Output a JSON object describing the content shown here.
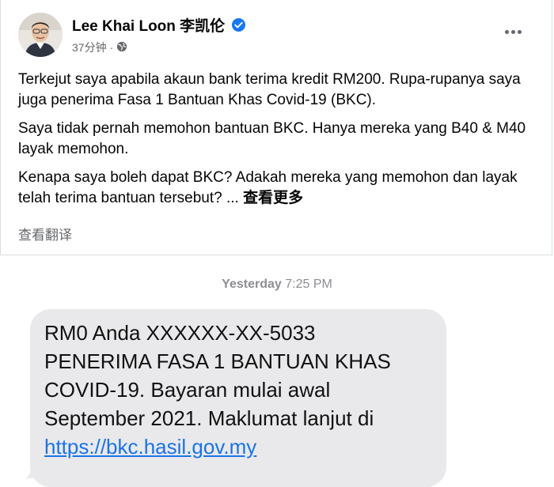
{
  "post": {
    "author_name": "Lee Khai Loon 李凯伦",
    "timestamp": "37分钟",
    "separator": "·",
    "paragraphs": [
      "Terkejut saya apabila akaun bank terima kredit RM200. Rupa-rupanya saya juga penerima Fasa 1 Bantuan Khas Covid-19 (BKC).",
      "Saya tidak pernah memohon bantuan BKC. Hanya mereka yang B40 & M40 layak memohon.",
      "Kenapa saya boleh dapat BKC? Adakah mereka yang memohon dan layak telah terima bantuan tersebut? ..."
    ],
    "see_more_label": "查看更多",
    "translate_label": "查看翻译",
    "verified_color": "#1877f2",
    "icons": {
      "audience": "globe-icon",
      "verified": "verified-badge-icon",
      "more": "more-options-icon"
    }
  },
  "sms": {
    "day": "Yesterday",
    "time": "7:25 PM",
    "message_lines": [
      "RM0 Anda XXXXXX-XX-5033",
      "PENERIMA FASA 1 BANTUAN KHAS",
      "COVID-19. Bayaran mulai awal",
      "September 2021. Maklumat lanjut di"
    ],
    "link": "https://bkc.hasil.gov.my",
    "bubble_color": "#e9e9eb"
  }
}
